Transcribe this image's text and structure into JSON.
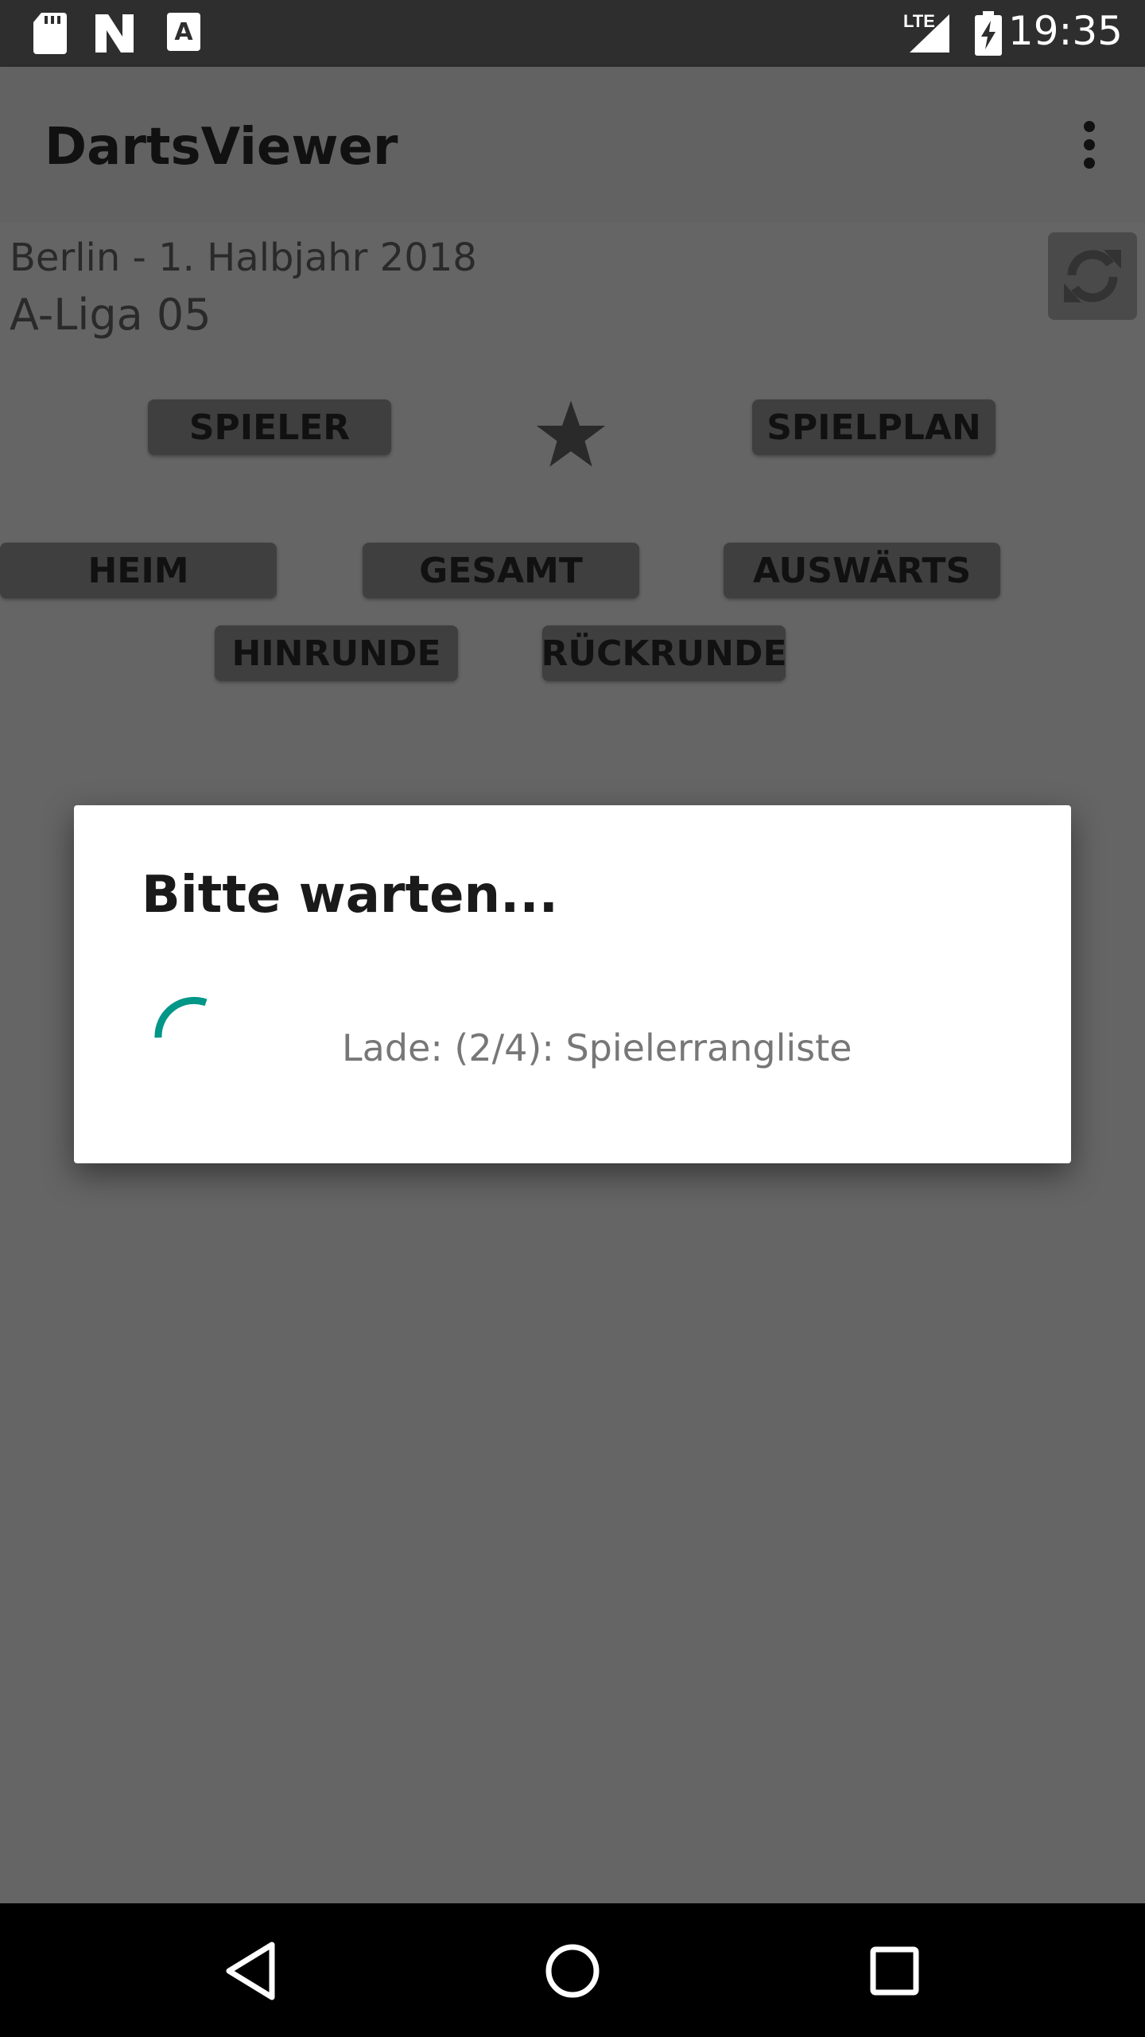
{
  "status_bar": {
    "time": "19:35",
    "network_label": "LTE",
    "icons": [
      "sd-card-icon",
      "n-logo-icon",
      "accessibility-icon",
      "signal-icon",
      "battery-charging-icon"
    ]
  },
  "app_bar": {
    "title": "DartsViewer",
    "menu_icon": "overflow-menu-icon"
  },
  "league": {
    "season": "Berlin - 1. Halbjahr 2018",
    "name": "A-Liga 05",
    "refresh_icon": "refresh-icon"
  },
  "tabs": {
    "players": "SPIELER",
    "favorite_icon": "star-icon",
    "schedule": "SPIELPLAN"
  },
  "filters": {
    "home": "HEIM",
    "total": "GESAMT",
    "away": "AUSWÄRTS",
    "first_round": "HINRUNDE",
    "second_round": "RÜCKRUNDE"
  },
  "dialog": {
    "title": "Bitte warten...",
    "message": "Lade: (2/4): Spielerrangliste",
    "accent_color": "#009688"
  },
  "nav_bar": {
    "back_icon": "back-icon",
    "home_icon": "home-icon",
    "recents_icon": "recents-icon"
  }
}
